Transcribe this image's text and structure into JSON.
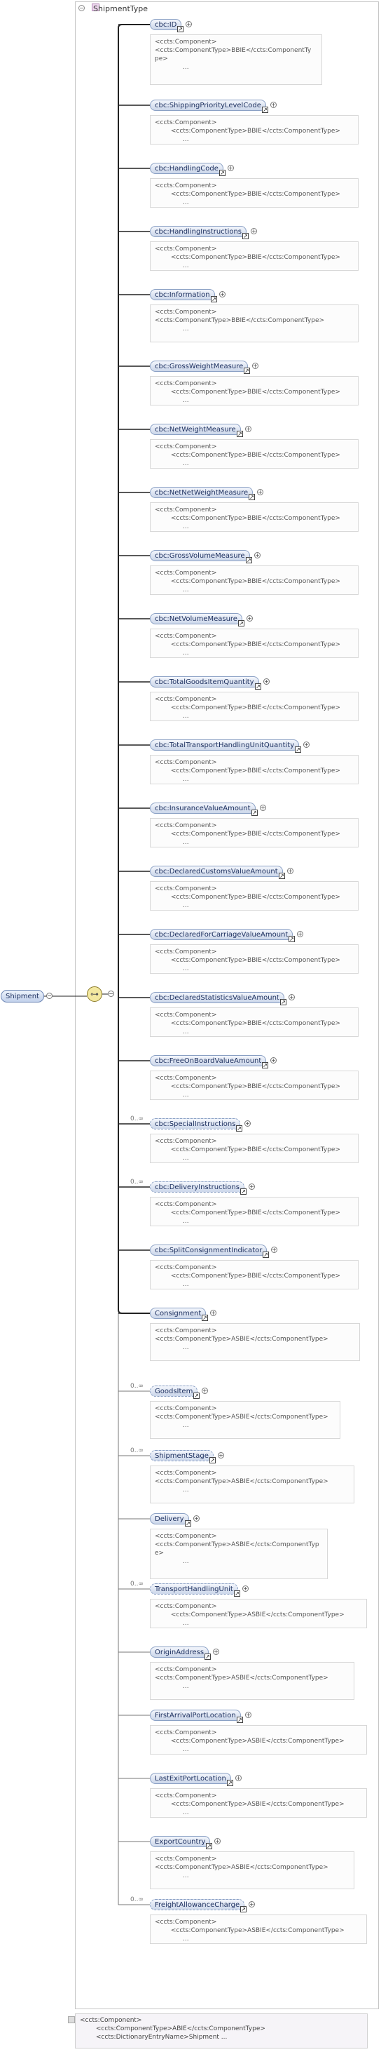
{
  "root": {
    "label": "Shipment"
  },
  "type_box": {
    "title": "ShipmentType"
  },
  "compositor_icon": "sequence-icon",
  "elements": [
    {
      "label": "cbc:ID",
      "card": "",
      "doc": [
        "<ccts:Component>",
        "<ccts:ComponentType>BBIE</ccts:ComponentTy",
        "pe>",
        "..."
      ]
    },
    {
      "label": "cbc:ShippingPriorityLevelCode",
      "card": "",
      "doc": [
        "<ccts:Component>",
        "        <ccts:ComponentType>BBIE</ccts:ComponentType>",
        "..."
      ]
    },
    {
      "label": "cbc:HandlingCode",
      "card": "",
      "doc": [
        "<ccts:Component>",
        "        <ccts:ComponentType>BBIE</ccts:ComponentType>",
        "..."
      ]
    },
    {
      "label": "cbc:HandlingInstructions",
      "card": "",
      "doc": [
        "<ccts:Component>",
        "        <ccts:ComponentType>BBIE</ccts:ComponentType>",
        "..."
      ]
    },
    {
      "label": "cbc:Information",
      "card": "",
      "doc": [
        "<ccts:Component>",
        "<ccts:ComponentType>BBIE</ccts:ComponentType>",
        "..."
      ]
    },
    {
      "label": "cbc:GrossWeightMeasure",
      "card": "",
      "doc": [
        "<ccts:Component>",
        "        <ccts:ComponentType>BBIE</ccts:ComponentType>",
        "..."
      ]
    },
    {
      "label": "cbc:NetWeightMeasure",
      "card": "",
      "doc": [
        "<ccts:Component>",
        "        <ccts:ComponentType>BBIE</ccts:ComponentType>",
        "..."
      ]
    },
    {
      "label": "cbc:NetNetWeightMeasure",
      "card": "",
      "doc": [
        "<ccts:Component>",
        "        <ccts:ComponentType>BBIE</ccts:ComponentType>",
        "..."
      ]
    },
    {
      "label": "cbc:GrossVolumeMeasure",
      "card": "",
      "doc": [
        "<ccts:Component>",
        "        <ccts:ComponentType>BBIE</ccts:ComponentType>",
        "..."
      ]
    },
    {
      "label": "cbc:NetVolumeMeasure",
      "card": "",
      "doc": [
        "<ccts:Component>",
        "        <ccts:ComponentType>BBIE</ccts:ComponentType>",
        "..."
      ]
    },
    {
      "label": "cbc:TotalGoodsItemQuantity",
      "card": "",
      "doc": [
        "<ccts:Component>",
        "        <ccts:ComponentType>BBIE</ccts:ComponentType>",
        "..."
      ]
    },
    {
      "label": "cbc:TotalTransportHandlingUnitQuantity",
      "card": "",
      "doc": [
        "<ccts:Component>",
        "        <ccts:ComponentType>BBIE</ccts:ComponentType>",
        "..."
      ]
    },
    {
      "label": "cbc:InsuranceValueAmount",
      "card": "",
      "doc": [
        "<ccts:Component>",
        "        <ccts:ComponentType>BBIE</ccts:ComponentType>",
        "..."
      ]
    },
    {
      "label": "cbc:DeclaredCustomsValueAmount",
      "card": "",
      "doc": [
        "<ccts:Component>",
        "        <ccts:ComponentType>BBIE</ccts:ComponentType>",
        "..."
      ]
    },
    {
      "label": "cbc:DeclaredForCarriageValueAmount",
      "card": "",
      "doc": [
        "<ccts:Component>",
        "        <ccts:ComponentType>BBIE</ccts:ComponentType>",
        "..."
      ]
    },
    {
      "label": "cbc:DeclaredStatisticsValueAmount",
      "card": "",
      "doc": [
        "<ccts:Component>",
        "        <ccts:ComponentType>BBIE</ccts:ComponentType>",
        "..."
      ]
    },
    {
      "label": "cbc:FreeOnBoardValueAmount",
      "card": "",
      "doc": [
        "<ccts:Component>",
        "        <ccts:ComponentType>BBIE</ccts:ComponentType>",
        "..."
      ]
    },
    {
      "label": "cbc:SpecialInstructions",
      "card": "0..∞",
      "doc": [
        "<ccts:Component>",
        "        <ccts:ComponentType>BBIE</ccts:ComponentType>",
        "..."
      ]
    },
    {
      "label": "cbc:DeliveryInstructions",
      "card": "0..∞",
      "doc": [
        "<ccts:Component>",
        "        <ccts:ComponentType>BBIE</ccts:ComponentType>",
        "..."
      ]
    },
    {
      "label": "cbc:SplitConsignmentIndicator",
      "card": "",
      "doc": [
        "<ccts:Component>",
        "        <ccts:ComponentType>BBIE</ccts:ComponentType>",
        "..."
      ]
    },
    {
      "label": "Consignment",
      "card": "",
      "doc": [
        "<ccts:Component>",
        "<ccts:ComponentType>ASBIE</ccts:ComponentType>",
        "..."
      ]
    },
    {
      "label": "GoodsItem",
      "card": "0..∞",
      "doc": [
        "<ccts:Component>",
        "<ccts:ComponentType>ASBIE</ccts:ComponentType>",
        "..."
      ]
    },
    {
      "label": "ShipmentStage",
      "card": "0..∞",
      "doc": [
        "<ccts:Component>",
        "<ccts:ComponentType>ASBIE</ccts:ComponentType>",
        "..."
      ]
    },
    {
      "label": "Delivery",
      "card": "",
      "doc": [
        "<ccts:Component>",
        "<ccts:ComponentType>ASBIE</ccts:ComponentTyp",
        "e>",
        "..."
      ]
    },
    {
      "label": "TransportHandlingUnit",
      "card": "0..∞",
      "doc": [
        "<ccts:Component>",
        "        <ccts:ComponentType>ASBIE</ccts:ComponentType>",
        "..."
      ]
    },
    {
      "label": "OriginAddress",
      "card": "",
      "doc": [
        "<ccts:Component>",
        "<ccts:ComponentType>ASBIE</ccts:ComponentType>",
        "..."
      ]
    },
    {
      "label": "FirstArrivalPortLocation",
      "card": "",
      "doc": [
        "<ccts:Component>",
        "        <ccts:ComponentType>ASBIE</ccts:ComponentType>",
        "..."
      ]
    },
    {
      "label": "LastExitPortLocation",
      "card": "",
      "doc": [
        "<ccts:Component>",
        "        <ccts:ComponentType>ASBIE</ccts:ComponentType>",
        "..."
      ]
    },
    {
      "label": "ExportCountry",
      "card": "",
      "doc": [
        "<ccts:Component>",
        "<ccts:ComponentType>ASBIE</ccts:ComponentType>",
        "..."
      ]
    },
    {
      "label": "FreightAllowanceCharge",
      "card": "0..∞",
      "doc": [
        "<ccts:Component>",
        "        <ccts:ComponentType>ASBIE</ccts:ComponentType>",
        "..."
      ]
    }
  ],
  "footer": {
    "lines": [
      "<ccts:Component>",
      "        <ccts:ComponentType>ABIE</ccts:ComponentType>",
      "        <ccts:DictionaryEntryName>Shipment ..."
    ]
  }
}
